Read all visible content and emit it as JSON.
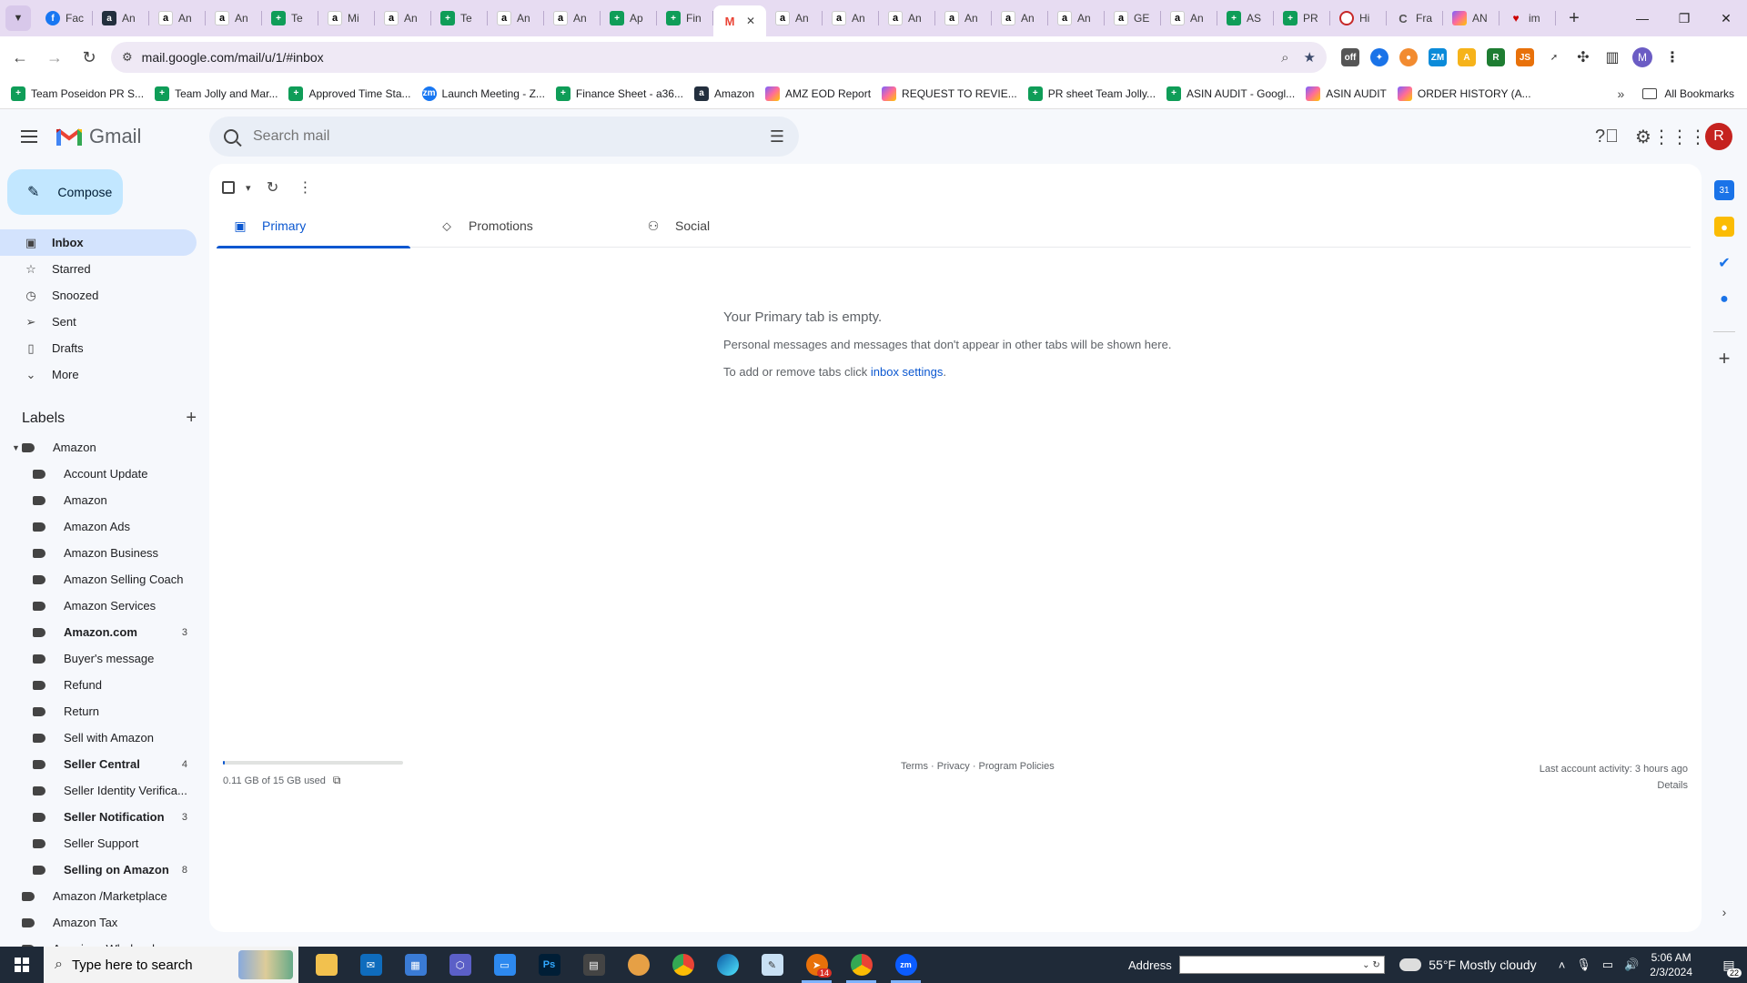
{
  "browser": {
    "tabs": [
      {
        "icon": "fav-fb",
        "glyph": "f",
        "label": "Fac"
      },
      {
        "icon": "fav-amzdark",
        "glyph": "a",
        "label": "An"
      },
      {
        "icon": "fav-amz",
        "glyph": "a",
        "label": "An"
      },
      {
        "icon": "fav-amz",
        "glyph": "a",
        "label": "An"
      },
      {
        "icon": "fav-sheets",
        "glyph": "+",
        "label": "Te"
      },
      {
        "icon": "fav-amz",
        "glyph": "a",
        "label": "Mi"
      },
      {
        "icon": "fav-amz",
        "glyph": "a",
        "label": "An"
      },
      {
        "icon": "fav-sheets",
        "glyph": "+",
        "label": "Te"
      },
      {
        "icon": "fav-amz",
        "glyph": "a",
        "label": "An"
      },
      {
        "icon": "fav-amz",
        "glyph": "a",
        "label": "An"
      },
      {
        "icon": "fav-sheets",
        "glyph": "+",
        "label": "Ap"
      },
      {
        "icon": "fav-sheets",
        "glyph": "+",
        "label": "Fin"
      },
      {
        "icon": "fav-gmail",
        "glyph": "M",
        "label": "",
        "active": true
      },
      {
        "icon": "fav-amz",
        "glyph": "a",
        "label": "An"
      },
      {
        "icon": "fav-amz",
        "glyph": "a",
        "label": "An"
      },
      {
        "icon": "fav-amz",
        "glyph": "a",
        "label": "An"
      },
      {
        "icon": "fav-amz",
        "glyph": "a",
        "label": "An"
      },
      {
        "icon": "fav-amz",
        "glyph": "a",
        "label": "An"
      },
      {
        "icon": "fav-amz",
        "glyph": "a",
        "label": "An"
      },
      {
        "icon": "fav-amz",
        "glyph": "a",
        "label": "GE"
      },
      {
        "icon": "fav-amz",
        "glyph": "a",
        "label": "An"
      },
      {
        "icon": "fav-sheets",
        "glyph": "+",
        "label": "AS"
      },
      {
        "icon": "fav-sheets",
        "glyph": "+",
        "label": "PR"
      },
      {
        "icon": "fav-red",
        "glyph": "",
        "label": "Hi"
      },
      {
        "icon": "fav-c",
        "glyph": "C",
        "label": "Fra"
      },
      {
        "icon": "fav-click",
        "glyph": "",
        "label": "AN"
      },
      {
        "icon": "fav-heart",
        "glyph": "♥",
        "label": "im"
      }
    ],
    "url": "mail.google.com/mail/u/1/#inbox",
    "profile_initial": "M",
    "bookmarks": [
      {
        "icon": "fav-sheets",
        "glyph": "+",
        "label": "Team Poseidon PR S..."
      },
      {
        "icon": "fav-sheets",
        "glyph": "+",
        "label": "Team Jolly and Mar..."
      },
      {
        "icon": "fav-sheets",
        "glyph": "+",
        "label": "Approved Time Sta..."
      },
      {
        "icon": "fav-fb",
        "glyph": "zm",
        "label": "Launch Meeting - Z..."
      },
      {
        "icon": "fav-sheets",
        "glyph": "+",
        "label": "Finance Sheet - a36..."
      },
      {
        "icon": "fav-amzdark",
        "glyph": "a",
        "label": "Amazon"
      },
      {
        "icon": "fav-click",
        "glyph": "",
        "label": "AMZ EOD Report"
      },
      {
        "icon": "fav-click",
        "glyph": "",
        "label": "REQUEST TO REVIE..."
      },
      {
        "icon": "fav-sheets",
        "glyph": "+",
        "label": "PR sheet Team Jolly..."
      },
      {
        "icon": "fav-sheets",
        "glyph": "+",
        "label": "ASIN AUDIT - Googl..."
      },
      {
        "icon": "fav-click",
        "glyph": "",
        "label": "ASIN AUDIT"
      },
      {
        "icon": "fav-click",
        "glyph": "",
        "label": "ORDER HISTORY (A..."
      }
    ],
    "all_bookmarks": "All Bookmarks"
  },
  "gmail": {
    "logo_text": "Gmail",
    "search_placeholder": "Search mail",
    "profile_initial": "R",
    "compose": "Compose",
    "nav": [
      {
        "icon": "▣",
        "label": "Inbox",
        "active": true,
        "name": "inbox"
      },
      {
        "icon": "☆",
        "label": "Starred",
        "name": "starred"
      },
      {
        "icon": "◷",
        "label": "Snoozed",
        "name": "snoozed"
      },
      {
        "icon": "➢",
        "label": "Sent",
        "name": "sent"
      },
      {
        "icon": "▯",
        "label": "Drafts",
        "name": "drafts"
      },
      {
        "icon": "⌄",
        "label": "More",
        "name": "more"
      }
    ],
    "labels_title": "Labels",
    "labels": [
      {
        "label": "Amazon",
        "level": 0,
        "caret": true
      },
      {
        "label": "Account Update",
        "level": 1
      },
      {
        "label": "Amazon",
        "level": 1
      },
      {
        "label": "Amazon Ads",
        "level": 1
      },
      {
        "label": "Amazon Business",
        "level": 1
      },
      {
        "label": "Amazon Selling Coach",
        "level": 1
      },
      {
        "label": "Amazon Services",
        "level": 1
      },
      {
        "label": "Amazon.com",
        "level": 1,
        "bold": true,
        "count": "3"
      },
      {
        "label": "Buyer's message",
        "level": 1
      },
      {
        "label": "Refund",
        "level": 1
      },
      {
        "label": "Return",
        "level": 1
      },
      {
        "label": "Sell with Amazon",
        "level": 1
      },
      {
        "label": "Seller Central",
        "level": 1,
        "bold": true,
        "count": "4"
      },
      {
        "label": "Seller Identity Verifica...",
        "level": 1
      },
      {
        "label": "Seller Notification",
        "level": 1,
        "bold": true,
        "count": "3"
      },
      {
        "label": "Seller Support",
        "level": 1
      },
      {
        "label": "Selling on Amazon",
        "level": 1,
        "bold": true,
        "count": "8"
      },
      {
        "label": "Amazon /Marketplace",
        "level": 0
      },
      {
        "label": "Amazon Tax",
        "level": 0
      },
      {
        "label": "American Wholesaler",
        "level": 0
      }
    ],
    "category_tabs": [
      {
        "icon": "▣",
        "label": "Primary",
        "active": true,
        "name": "primary"
      },
      {
        "icon": "⬦",
        "label": "Promotions",
        "name": "promotions"
      },
      {
        "icon": "⚇",
        "label": "Social",
        "name": "social"
      }
    ],
    "empty": {
      "title": "Your Primary tab is empty.",
      "line1": "Personal messages and messages that don't appear in other tabs will be shown here.",
      "line2_prefix": "To add or remove tabs click ",
      "line2_link": "inbox settings",
      "line2_suffix": "."
    },
    "footer": {
      "storage": "0.11 GB of 15 GB used",
      "storage_fraction": 0.007,
      "links": "Terms · Privacy · Program Policies",
      "activity": "Last account activity: 3 hours ago",
      "details": "Details"
    }
  },
  "taskbar": {
    "search_placeholder": "Type here to search",
    "address_label": "Address",
    "weather": "55°F  Mostly cloudy",
    "time": "5:06 AM",
    "date": "2/3/2024",
    "notification_count": "22",
    "telegram_badge": "14"
  }
}
